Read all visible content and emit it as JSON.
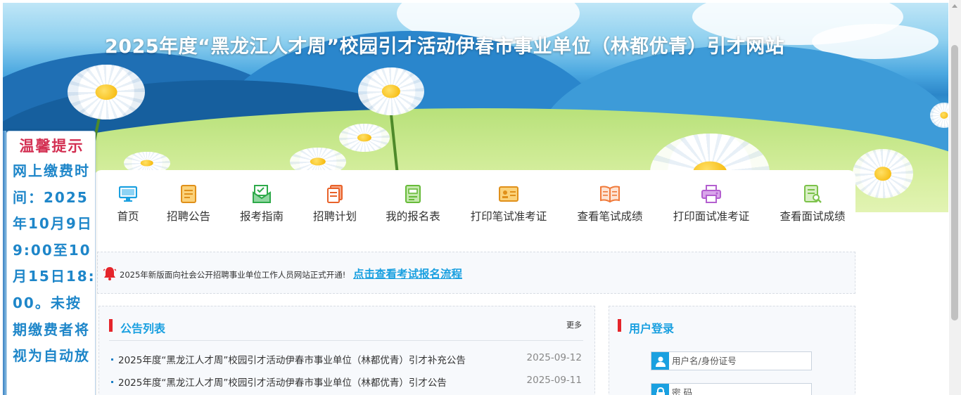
{
  "banner": {
    "title": "2025年度“黑龙江人才周”校园引才活动伊春市事业单位（林都优青）引才网站"
  },
  "nav": {
    "items": [
      {
        "label": "首页",
        "icon": "monitor-icon",
        "color": "#1aa0e0"
      },
      {
        "label": "招聘公告",
        "icon": "document-icon",
        "color": "#f0a21a"
      },
      {
        "label": "报考指南",
        "icon": "mail-check-icon",
        "color": "#2eaa4a"
      },
      {
        "label": "招聘计划",
        "icon": "pages-icon",
        "color": "#e8622a"
      },
      {
        "label": "我的报名表",
        "icon": "form-icon",
        "color": "#67bb3a"
      },
      {
        "label": "打印笔试准考证",
        "icon": "id-card-icon",
        "color": "#f0a21a"
      },
      {
        "label": "查看笔试成绩",
        "icon": "open-book-icon",
        "color": "#f07a3a"
      },
      {
        "label": "打印面试准考证",
        "icon": "printer-icon",
        "color": "#b45fd0"
      },
      {
        "label": "查看面试成绩",
        "icon": "search-doc-icon",
        "color": "#7cc24a"
      }
    ]
  },
  "notice": {
    "text": "2025年新版面向社会公开招聘事业单位工作人员网站正式开通!",
    "link": "点击查看考试报名流程",
    "icon": "bell-icon"
  },
  "announcements": {
    "title": "公告列表",
    "more": "更多",
    "items": [
      {
        "title": "2025年度“黑龙江人才周”校园引才活动伊春市事业单位（林都优青）引才补充公告",
        "date": "2025-09-12"
      },
      {
        "title": "2025年度“黑龙江人才周”校园引才活动伊春市事业单位（林都优青）引才公告",
        "date": "2025-09-11"
      }
    ]
  },
  "login": {
    "title": "用户登录",
    "username_placeholder": "用户名/身份证号",
    "password_placeholder": "密 码",
    "username_icon": "user-icon",
    "password_icon": "lock-icon"
  },
  "tip": {
    "title": "温馨提示",
    "body": "网上缴费时间：2025年10月9日9:00至10月15日18:00。未按期缴费者将视为自动放"
  },
  "colors": {
    "accent": "#1aa0e0",
    "section_bar": "#e5252b",
    "tip_title": "#d32f52",
    "tip_body": "#1e86c9"
  }
}
